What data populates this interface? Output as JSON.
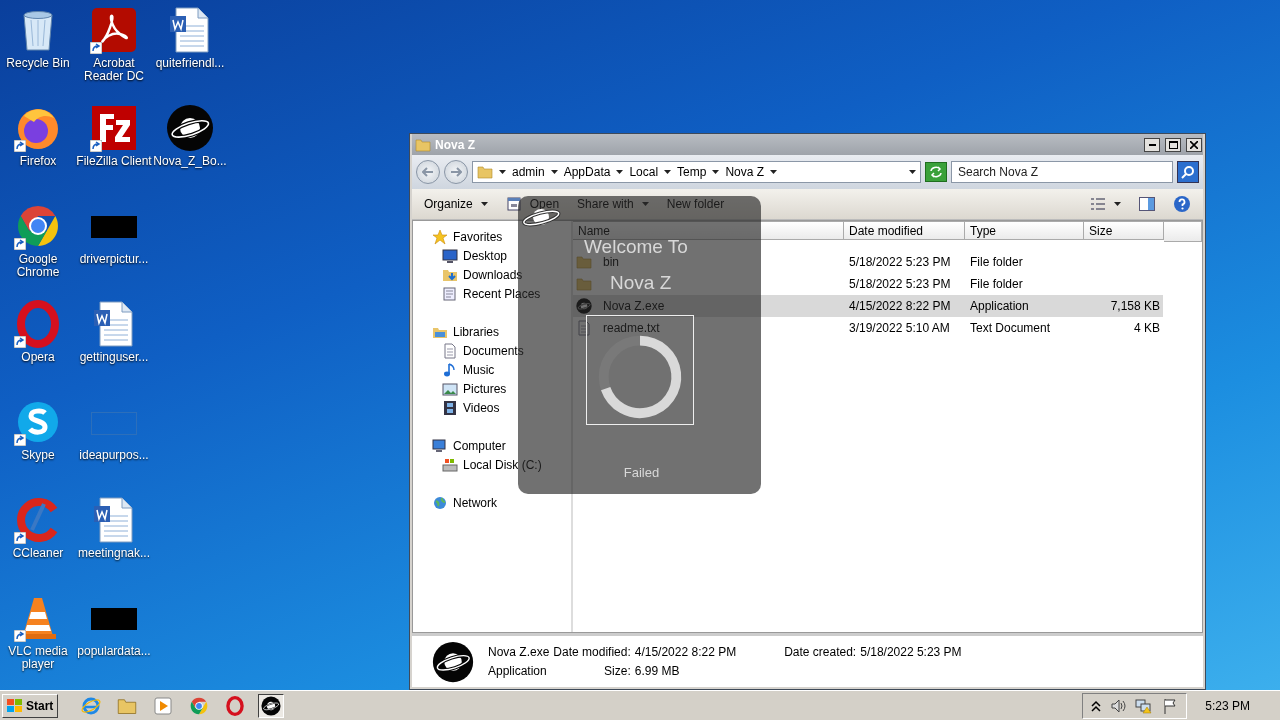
{
  "desktop_icons": [
    {
      "label": "Recycle Bin",
      "kind": "recycle",
      "shortcut": false
    },
    {
      "label": "Firefox",
      "kind": "firefox",
      "shortcut": true
    },
    {
      "label": "Google Chrome",
      "kind": "chrome",
      "shortcut": true
    },
    {
      "label": "Opera",
      "kind": "opera",
      "shortcut": true
    },
    {
      "label": "Skype",
      "kind": "skype",
      "shortcut": true
    },
    {
      "label": "CCleaner",
      "kind": "ccleaner",
      "shortcut": true
    },
    {
      "label": "VLC media player",
      "kind": "vlc",
      "shortcut": true
    },
    {
      "label": "Acrobat Reader DC",
      "kind": "acrobat",
      "shortcut": true
    },
    {
      "label": "FileZilla Client",
      "kind": "filezilla",
      "shortcut": true
    },
    {
      "label": "driverpictur...",
      "kind": "black",
      "shortcut": false
    },
    {
      "label": "gettinguser...",
      "kind": "word",
      "shortcut": false
    },
    {
      "label": "ideapurpos...",
      "kind": "blank",
      "shortcut": false
    },
    {
      "label": "meetingnak...",
      "kind": "word",
      "shortcut": false
    },
    {
      "label": "populardata...",
      "kind": "black",
      "shortcut": false
    },
    {
      "label": "quitefriendl...",
      "kind": "word",
      "shortcut": false
    },
    {
      "label": "Nova_Z_Bo...",
      "kind": "novaz",
      "shortcut": false
    }
  ],
  "explorer": {
    "title": "Nova Z",
    "breadcrumb": [
      "admin",
      "AppData",
      "Local",
      "Temp",
      "Nova Z"
    ],
    "search": {
      "placeholder": "Search Nova Z"
    },
    "toolbar": [
      {
        "label": "Organize",
        "menu": true,
        "kind": "plain"
      },
      {
        "label": "Open",
        "menu": false,
        "kind": "open"
      },
      {
        "label": "Share with",
        "menu": true,
        "kind": "plain"
      },
      {
        "label": "New folder",
        "menu": false,
        "kind": "plain"
      }
    ],
    "nav": [
      {
        "label": "Favorites",
        "kind": "star",
        "children": [
          {
            "label": "Desktop",
            "kind": "desktop"
          },
          {
            "label": "Downloads",
            "kind": "downloads"
          },
          {
            "label": "Recent Places",
            "kind": "recent"
          }
        ]
      },
      {
        "label": "Libraries",
        "kind": "libraries",
        "children": [
          {
            "label": "Documents",
            "kind": "documents"
          },
          {
            "label": "Music",
            "kind": "music"
          },
          {
            "label": "Pictures",
            "kind": "pictures"
          },
          {
            "label": "Videos",
            "kind": "videos"
          }
        ]
      },
      {
        "label": "Computer",
        "kind": "computer",
        "children": [
          {
            "label": "Local Disk (C:)",
            "kind": "disk"
          }
        ]
      },
      {
        "label": "Network",
        "kind": "network"
      }
    ],
    "columns": [
      "Name",
      "Date modified",
      "Type",
      "Size"
    ],
    "rows": [
      {
        "name": "bin",
        "kind": "folder",
        "date": "5/18/2022 5:23 PM",
        "type": "File folder",
        "selected": false
      },
      {
        "kind": "folder",
        "date": "5/18/2022 5:23 PM",
        "type": "File folder",
        "selected": false
      },
      {
        "name": "Nova Z.exe",
        "kind": "app",
        "date": "4/15/2022 8:22 PM",
        "type": "Application",
        "size": "7,158 KB",
        "selected": true
      },
      {
        "name": "readme.txt",
        "kind": "text",
        "date": "3/19/2022 5:10 AM",
        "type": "Text Document",
        "size": "4 KB",
        "selected": false
      }
    ],
    "details": {
      "name": "Nova Z.exe",
      "type": "Application",
      "modified_label": "Date modified:",
      "modified": "4/15/2022 8:22 PM",
      "size_label": "Size:",
      "size": "6.99 MB",
      "created_label": "Date created:",
      "created": "5/18/2022 5:23 PM"
    }
  },
  "splash": {
    "title": "Welcome To",
    "name": "Nova Z",
    "status": "Failed"
  },
  "taskbar": {
    "start": "Start",
    "apps": [
      {
        "kind": "ie",
        "active": false
      },
      {
        "kind": "explorer",
        "active": false
      },
      {
        "kind": "media",
        "active": false
      },
      {
        "kind": "chrome",
        "active": false
      },
      {
        "kind": "opera",
        "active": false
      },
      {
        "kind": "novaz",
        "active": true
      }
    ],
    "clock": "5:23 PM"
  }
}
